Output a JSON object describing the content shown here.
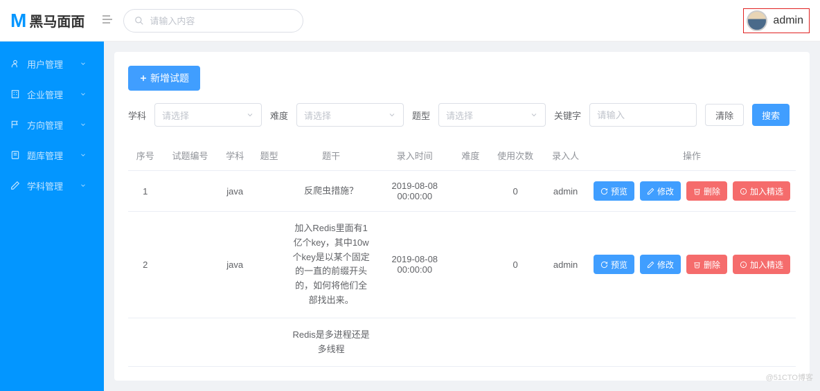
{
  "header": {
    "app_name": "黑马面面",
    "search_placeholder": "请输入内容",
    "username": "admin"
  },
  "sidebar": {
    "items": [
      {
        "label": "用户管理"
      },
      {
        "label": "企业管理"
      },
      {
        "label": "方向管理"
      },
      {
        "label": "题库管理"
      },
      {
        "label": "学科管理"
      }
    ]
  },
  "toolbar": {
    "add_label": "新增试题"
  },
  "filters": {
    "subject_label": "学科",
    "subject_placeholder": "请选择",
    "difficulty_label": "难度",
    "difficulty_placeholder": "请选择",
    "type_label": "题型",
    "type_placeholder": "请选择",
    "keyword_label": "关键字",
    "keyword_placeholder": "请输入",
    "clear_label": "清除",
    "search_label": "搜索"
  },
  "table": {
    "headers": {
      "index": "序号",
      "qid": "试题编号",
      "subject": "学科",
      "type": "题型",
      "title": "题干",
      "entry_time": "录入时间",
      "difficulty": "难度",
      "use_count": "使用次数",
      "entry_user": "录入人",
      "actions": "操作"
    },
    "rows": [
      {
        "index": "1",
        "qid": "",
        "subject": "java",
        "type": "",
        "title": "反爬虫措施？",
        "entry_time": "2019-08-08 00:00:00",
        "difficulty": "",
        "use_count": "0",
        "entry_user": "admin"
      },
      {
        "index": "2",
        "qid": "",
        "subject": "java",
        "type": "",
        "title": "加入Redis里面有1亿个key，其中10w个key是以某个固定的一直的前缀开头的，如何将他们全部找出来。",
        "entry_time": "2019-08-08 00:00:00",
        "difficulty": "",
        "use_count": "0",
        "entry_user": "admin"
      },
      {
        "index": "",
        "qid": "",
        "subject": "",
        "type": "",
        "title": "Redis是多进程还是多线程",
        "entry_time": "",
        "difficulty": "",
        "use_count": "",
        "entry_user": ""
      }
    ],
    "actions": {
      "preview": "预览",
      "edit": "修改",
      "delete": "删除",
      "featured": "加入精选"
    }
  },
  "watermark": "@51CTO博客"
}
